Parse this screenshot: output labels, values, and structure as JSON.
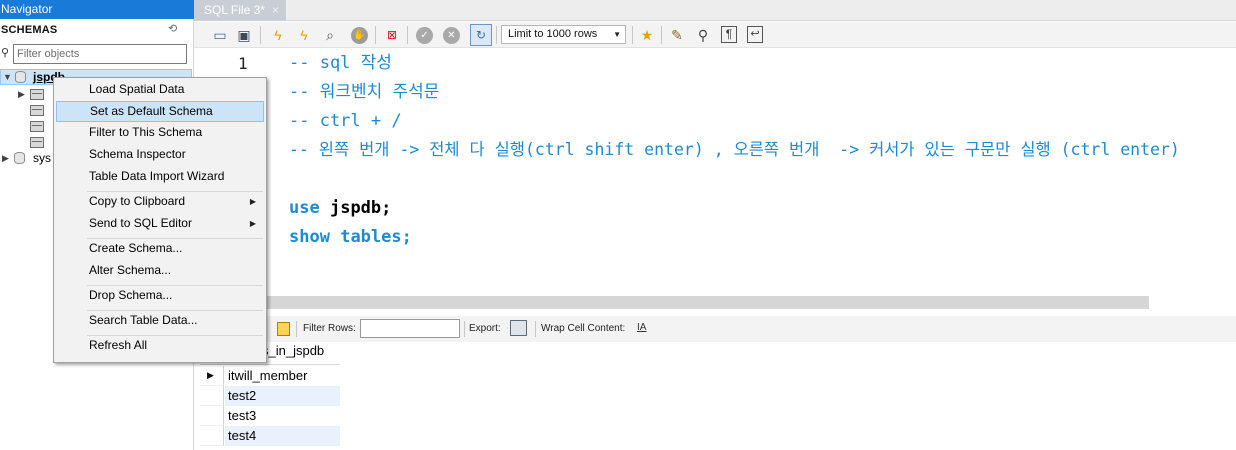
{
  "navigator": {
    "title": "Navigator",
    "schemas_label": "SCHEMAS",
    "filter_placeholder": "Filter objects",
    "tree": [
      {
        "label": "jspdb",
        "expanded": true,
        "selected": true
      },
      {
        "label": "sys",
        "expanded": false,
        "selected": false
      }
    ]
  },
  "editor_tab": {
    "label": "SQL File 3*",
    "close": "×"
  },
  "toolbar": {
    "limit_select": "Limit to 1000 rows",
    "icons": [
      "open-file-icon",
      "save-icon",
      "execute-icon",
      "execute-current-icon",
      "explain-icon",
      "stop-icon",
      "toggle-result-icon",
      "commit-icon",
      "rollback-icon",
      "autocommit-icon",
      "bookmark-icon",
      "beautify-icon",
      "find-icon",
      "invisible-chars-icon",
      "wrap-icon"
    ]
  },
  "editor": {
    "line_number": "1",
    "lines": [
      "-- sql 작성",
      "-- 워크벤치 주석문",
      "-- ctrl + /",
      "-- 왼쪽 번개 -> 전체 다 실행(ctrl shift enter) , 오른쪽 번개  -> 커서가 있는 구문만 실행 (ctrl enter)",
      "",
      "use",
      "jspdb;",
      "show",
      "tables;"
    ]
  },
  "result_bar": {
    "filter_rows": "Filter Rows:",
    "export": "Export:",
    "wrap_cell": "Wrap Cell Content:",
    "wrap_icon_text": "IA"
  },
  "result_grid": {
    "column": "s_in_jspdb",
    "rows": [
      "itwill_member",
      "test2",
      "test3",
      "test4"
    ]
  },
  "context_menu": {
    "items": [
      {
        "label": "Load Spatial Data"
      },
      {
        "label": "Set as Default Schema",
        "highlighted": true
      },
      {
        "label": "Filter to This Schema"
      },
      {
        "label": "Schema Inspector"
      },
      {
        "label": "Table Data Import Wizard"
      },
      {
        "label": "Copy to Clipboard",
        "submenu": true
      },
      {
        "label": "Send to SQL Editor",
        "submenu": true
      },
      {
        "label": "Create Schema..."
      },
      {
        "label": "Alter Schema..."
      },
      {
        "label": "Drop Schema..."
      },
      {
        "label": "Search Table Data..."
      },
      {
        "label": "Refresh All"
      }
    ]
  },
  "colors": {
    "navigator_title_bg": "#1a7ad7",
    "comment": "#1c8bd4",
    "selection": "#cce4f7"
  }
}
